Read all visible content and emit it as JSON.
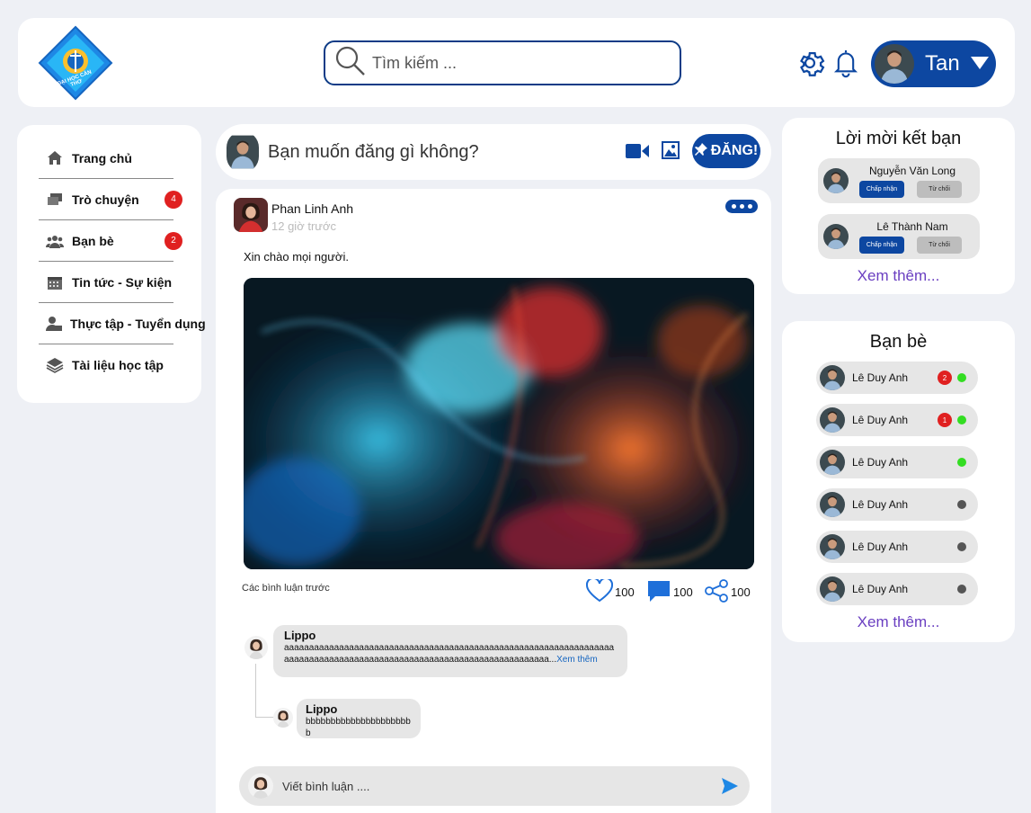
{
  "header": {
    "logo_text": "ĐẠI HỌC CẦN THƠ",
    "search_placeholder": "Tìm kiếm ...",
    "user_name": "Tan"
  },
  "sidebar": {
    "items": [
      {
        "label": "Trang chủ",
        "icon": "home-icon"
      },
      {
        "label": "Trò chuyện",
        "icon": "chat-icon",
        "badge": "4"
      },
      {
        "label": "Bạn bè",
        "icon": "friends-icon",
        "badge": "2"
      },
      {
        "label": "Tin tức - Sự kiện",
        "icon": "calendar-icon"
      },
      {
        "label": "Thực tập - Tuyển dụng",
        "icon": "user-job-icon"
      },
      {
        "label": "Tài liệu học tập",
        "icon": "layers-icon"
      }
    ]
  },
  "composer": {
    "placeholder": "Bạn muốn đăng gì không?",
    "post_label": "ĐĂNG!"
  },
  "post": {
    "author": "Phan Linh Anh",
    "time": "12 giờ trước",
    "text": "Xin chào mọi người.",
    "previous_comments_label": "Các bình luận trước",
    "likes": "100",
    "comments": "100",
    "shares": "100",
    "comments_list": [
      {
        "name": "Lippo",
        "text": "aaaaaaaaaaaaaaaaaaaaaaaaaaaaaaaaaaaaaaaaaaaaaaaaaaaaaaaaaaaaaaaaaaaaaaaaaaaaaaaaaaaaaaaaaaaaaaaaaaaaaaaaaaaaaaaaaaaaaaa...",
        "see_more": "Xem thêm"
      },
      {
        "name": "Lippo",
        "text": "bbbbbbbbbbbbbbbbbbbbbb"
      }
    ],
    "comment_placeholder": "Viết bình luận ...."
  },
  "friend_requests": {
    "title": "Lời mời kết bạn",
    "items": [
      {
        "name": "Nguyễn Văn Long",
        "accept": "Chấp nhận",
        "decline": "Từ chối"
      },
      {
        "name": "Lê Thành Nam",
        "accept": "Chấp nhận",
        "decline": "Từ chối"
      }
    ],
    "see_more": "Xem thêm..."
  },
  "friends": {
    "title": "Bạn bè",
    "items": [
      {
        "name": "Lê Duy Anh",
        "badge": "2",
        "status": "online"
      },
      {
        "name": "Lê Duy Anh",
        "badge": "1",
        "status": "online"
      },
      {
        "name": "Lê Duy Anh",
        "status": "online"
      },
      {
        "name": "Lê Duy Anh",
        "status": "offline"
      },
      {
        "name": "Lê Duy Anh",
        "status": "offline"
      },
      {
        "name": "Lê Duy Anh",
        "status": "offline"
      }
    ],
    "see_more": "Xem thêm..."
  },
  "colors": {
    "primary": "#0d47a1",
    "online": "#33dd22",
    "offline": "#555555",
    "badge": "#e02020",
    "link": "#6a3fc1"
  }
}
